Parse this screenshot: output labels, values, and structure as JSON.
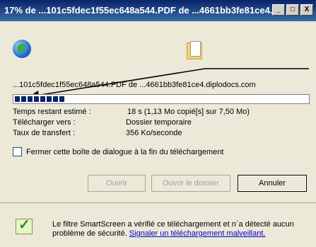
{
  "window": {
    "title": "17% de ...101c5fdec1f55ec648a544.PDF de ...4661bb3fe81ce4...",
    "minimize_glyph": "_",
    "maximize_glyph": "□",
    "close_glyph": "X"
  },
  "icons": {
    "source": "globe-icon",
    "destination": "folder-icon",
    "footer": "smartscreen-shield-icon"
  },
  "download": {
    "path_text": "...101c5fdec1f55ec648a544.PDF de ...4661bb3fe81ce4.diplodocs.com",
    "progress_fraction": 0.17
  },
  "details": [
    {
      "label": "Temps restant estimé :",
      "value": "18 s (1,13 Mo copié[s] sur 7,50 Mo)"
    },
    {
      "label": "Télécharger vers :",
      "value": "Dossier temporaire"
    },
    {
      "label": "Taux de transfert :",
      "value": "356 Ko/seconde"
    }
  ],
  "close_on_complete": {
    "label": "Fermer cette boîte de dialogue à la fin du téléchargement",
    "checked": false
  },
  "buttons": {
    "open": "Ouvrir",
    "open_folder": "Ouvrir le dossier",
    "cancel": "Annuler"
  },
  "smartscreen": {
    "text": "Le filtre SmartScreen a vérifié ce téléchargement et n´a détecté aucun problème de sécurité.",
    "link": "Signaler un téléchargement malveillant."
  }
}
